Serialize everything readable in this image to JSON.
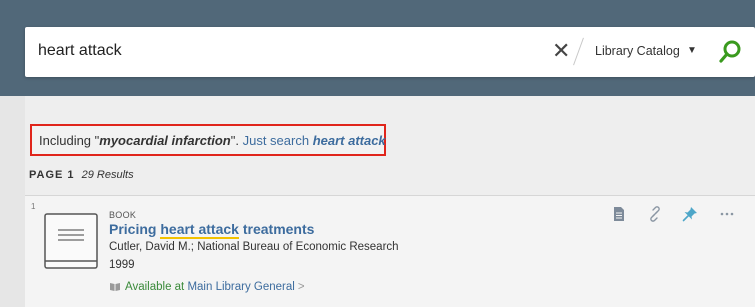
{
  "search": {
    "query": "heart attack",
    "clear_symbol": "✕",
    "scope_label": "Library Catalog",
    "scope_caret": "▼"
  },
  "notice": {
    "prefix": "Including \"",
    "expanded_term": "myocardial infarction",
    "suffix": "\". ",
    "link_text": "Just search ",
    "link_term": "heart attack"
  },
  "pagination": {
    "page_label": "PAGE 1",
    "results_count": "29 Results"
  },
  "result": {
    "index": "1",
    "type": "BOOK",
    "title_prefix": "Pricing ",
    "title_highlight": "heart attack",
    "title_suffix": " treatments",
    "author": "Cutler, David M.; National Bureau of Economic Research",
    "year": "1999",
    "availability_status": "Available at ",
    "availability_location": "Main Library  General",
    "availability_caret": ">"
  },
  "icons": {
    "search": "search-icon",
    "book": "book-icon",
    "document": "document-icon",
    "link": "link-icon",
    "pin": "pin-icon",
    "more": "more-icon",
    "availability": "book-open-icon"
  },
  "colors": {
    "header_band": "#516879",
    "link": "#3d6c9e",
    "available": "#3a8a3a",
    "highlight_border": "#e0251b",
    "search_green": "#3a9a1e",
    "pin_blue": "#4da6c8"
  }
}
